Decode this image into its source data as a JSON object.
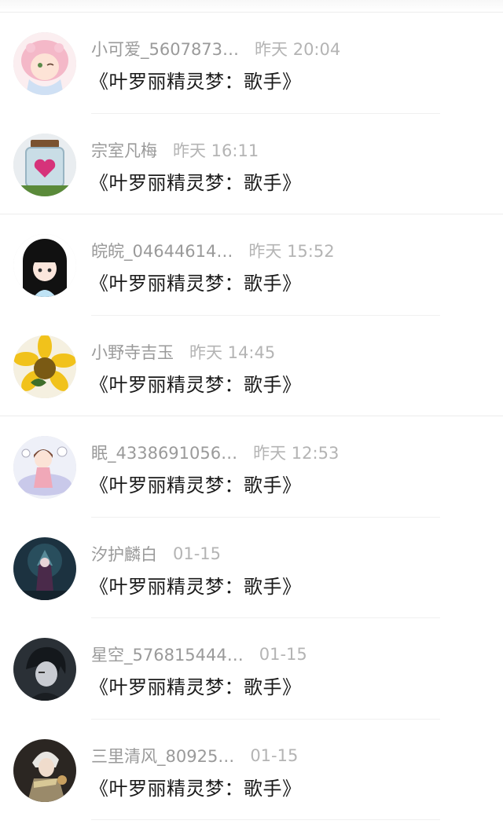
{
  "comments": [
    {
      "user": "小可爱_5607873…",
      "time": "昨天 20:04",
      "text": "《叶罗丽精灵梦：歌手》",
      "avatar": "anime-girl-pink-hair-avatar"
    },
    {
      "user": "宗室凡梅",
      "time": "昨天 16:11",
      "text": "《叶罗丽精灵梦：歌手》",
      "avatar": "heart-jar-avatar"
    },
    {
      "user": "皖皖_04644614…",
      "time": "昨天 15:52",
      "text": "《叶罗丽精灵梦：歌手》",
      "avatar": "black-hair-girl-avatar"
    },
    {
      "user": "小野寺吉玉",
      "time": "昨天 14:45",
      "text": "《叶罗丽精灵梦：歌手》",
      "avatar": "sunflower-avatar"
    },
    {
      "user": "眠_4338691056…",
      "time": "昨天 12:53",
      "text": "《叶罗丽精灵梦：歌手》",
      "avatar": "sleeping-girl-avatar"
    },
    {
      "user": "汐护麟白",
      "time": "01-15",
      "text": "《叶罗丽精灵梦：歌手》",
      "avatar": "dark-fantasy-avatar"
    },
    {
      "user": "星空_576815444…",
      "time": "01-15",
      "text": "《叶罗丽精灵梦：歌手》",
      "avatar": "dark-anime-boy-avatar"
    },
    {
      "user": "三里清风_80925…",
      "time": "01-15",
      "text": "《叶罗丽精灵梦：歌手》",
      "avatar": "armored-warrior-avatar"
    }
  ]
}
